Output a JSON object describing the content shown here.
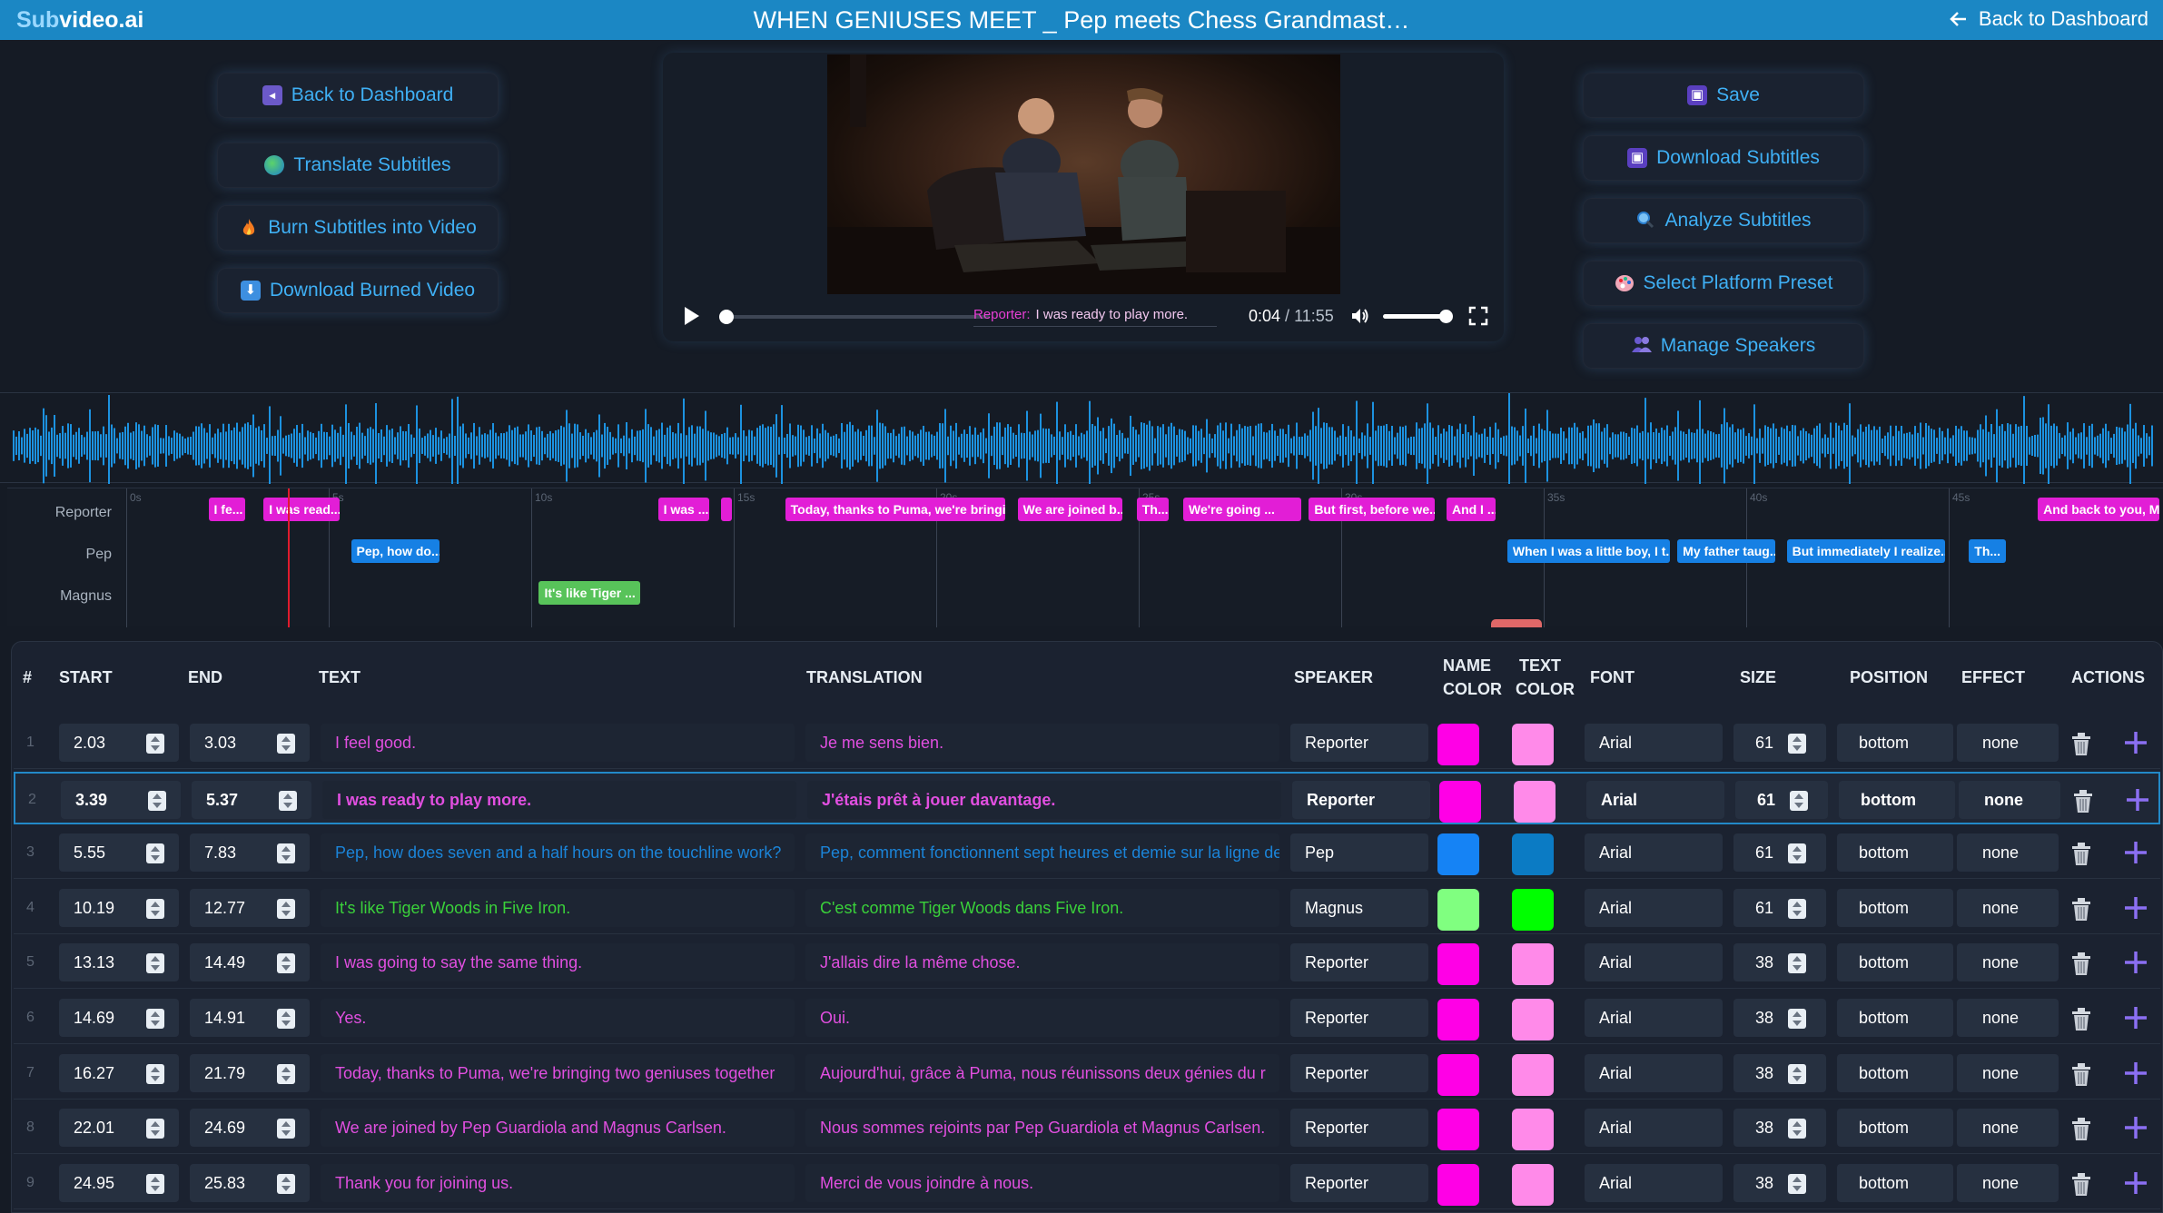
{
  "app": {
    "brand_prefix": "Sub",
    "brand_suffix": "video.ai",
    "video_title": "WHEN GENIUSES MEET _ Pep meets Chess Grandmast…",
    "back_top": "Back to Dashboard"
  },
  "left_buttons": [
    {
      "label": "Back to Dashboard",
      "icon": "back-icon"
    },
    {
      "label": "Translate Subtitles",
      "icon": "globe-icon"
    },
    {
      "label": "Burn Subtitles into Video",
      "icon": "fire-icon"
    },
    {
      "label": "Download Burned Video",
      "icon": "download-arrow-icon"
    }
  ],
  "right_buttons": [
    {
      "label": "Save",
      "icon": "floppy-icon"
    },
    {
      "label": "Download Subtitles",
      "icon": "floppy-icon"
    },
    {
      "label": "Analyze Subtitles",
      "icon": "magnifier-icon"
    },
    {
      "label": "Select Platform Preset",
      "icon": "palette-icon"
    },
    {
      "label": "Manage Speakers",
      "icon": "people-icon"
    }
  ],
  "player": {
    "current_speaker": "Reporter:",
    "current_caption": "I was ready to play more.",
    "current_time": "0:04",
    "separator": " / ",
    "duration": "11:55",
    "progress": 0.006,
    "volume": 1.0
  },
  "timeline": {
    "tracks": [
      "Reporter",
      "Pep",
      "Magnus"
    ],
    "ticks": [
      "0s",
      "5s",
      "10s",
      "15s",
      "20s",
      "25s",
      "30s",
      "35s",
      "40s",
      "45s"
    ],
    "clips": [
      {
        "track": 0,
        "start": 2.03,
        "end": 3.03,
        "label": "I fe..."
      },
      {
        "track": 0,
        "start": 3.39,
        "end": 5.37,
        "label": "I was read..."
      },
      {
        "track": 1,
        "start": 5.55,
        "end": 7.83,
        "label": "Pep, how do..."
      },
      {
        "track": 2,
        "start": 10.19,
        "end": 12.77,
        "label": "It's like Tiger ..."
      },
      {
        "track": 0,
        "start": 13.13,
        "end": 14.49,
        "label": "I was ..."
      },
      {
        "track": 0,
        "start": 14.69,
        "end": 14.91,
        "label": ""
      },
      {
        "track": 0,
        "start": 16.27,
        "end": 21.79,
        "label": "Today, thanks to Puma, we're bringi..."
      },
      {
        "track": 0,
        "start": 22.01,
        "end": 24.69,
        "label": "We are joined b..."
      },
      {
        "track": 0,
        "start": 24.95,
        "end": 25.83,
        "label": "Th..."
      },
      {
        "track": 0,
        "start": 26.1,
        "end": 29.1,
        "label": "We're going ..."
      },
      {
        "track": 0,
        "start": 29.2,
        "end": 32.4,
        "label": "But first, before we..."
      },
      {
        "track": 0,
        "start": 32.6,
        "end": 33.9,
        "label": "And I ..."
      },
      {
        "track": 1,
        "start": 34.1,
        "end": 38.2,
        "label": "When I was a little boy, I t..."
      },
      {
        "track": 1,
        "start": 38.3,
        "end": 40.8,
        "label": "My father taug..."
      },
      {
        "track": 1,
        "start": 41.0,
        "end": 45.0,
        "label": "But immediately I realize..."
      },
      {
        "track": 1,
        "start": 45.5,
        "end": 46.5,
        "label": "Th..."
      },
      {
        "track": 0,
        "start": 47.2,
        "end": 50.5,
        "label": "And back to you, M..."
      }
    ]
  },
  "table": {
    "headers": {
      "num": "#",
      "start": "START",
      "end": "END",
      "text": "TEXT",
      "translation": "TRANSLATION",
      "speaker": "SPEAKER",
      "name_color_1": "NAME",
      "name_color_2": "COLOR",
      "text_color_1": "TEXT",
      "text_color_2": "COLOR",
      "font": "FONT",
      "size": "SIZE",
      "position": "POSITION",
      "effect": "EFFECT",
      "actions": "ACTIONS"
    },
    "rows": [
      {
        "num": "1",
        "start": "2.03",
        "end": "3.03",
        "text": "I feel good.",
        "translation": "Je me sens bien.",
        "speaker": "Reporter",
        "name_color": "#ff00e6",
        "text_color": "#ff8ae9",
        "font": "Arial",
        "size": "61",
        "position": "bottom",
        "effect": "none"
      },
      {
        "num": "2",
        "start": "3.39",
        "end": "5.37",
        "text": "I was ready to play more.",
        "translation": "J'étais prêt à jouer davantage.",
        "speaker": "Reporter",
        "name_color": "#ff00e6",
        "text_color": "#ff8ae9",
        "font": "Arial",
        "size": "61",
        "position": "bottom",
        "effect": "none",
        "selected": true
      },
      {
        "num": "3",
        "start": "5.55",
        "end": "7.83",
        "text": "Pep, how does seven and a half hours on the touchline work?",
        "translation": "Pep, comment fonctionnent sept heures et demie sur la ligne de touche ?",
        "speaker": "Pep",
        "name_color": "#1583f5",
        "text_color": "#0b7bc4",
        "font": "Arial",
        "size": "61",
        "position": "bottom",
        "effect": "none"
      },
      {
        "num": "4",
        "start": "10.19",
        "end": "12.77",
        "text": "It's like Tiger Woods in Five Iron.",
        "translation": "C'est comme Tiger Woods dans Five Iron.",
        "speaker": "Magnus",
        "name_color": "#80ff80",
        "text_color": "#00ff00",
        "font": "Arial",
        "size": "61",
        "position": "bottom",
        "effect": "none"
      },
      {
        "num": "5",
        "start": "13.13",
        "end": "14.49",
        "text": "I was going to say the same thing.",
        "translation": "J'allais dire la même chose.",
        "speaker": "Reporter",
        "name_color": "#ff00e6",
        "text_color": "#ff8ae9",
        "font": "Arial",
        "size": "38",
        "position": "bottom",
        "effect": "none"
      },
      {
        "num": "6",
        "start": "14.69",
        "end": "14.91",
        "text": "Yes.",
        "translation": "Oui.",
        "speaker": "Reporter",
        "name_color": "#ff00e6",
        "text_color": "#ff8ae9",
        "font": "Arial",
        "size": "38",
        "position": "bottom",
        "effect": "none"
      },
      {
        "num": "7",
        "start": "16.27",
        "end": "21.79",
        "text": "Today, thanks to Puma, we're bringing two geniuses together",
        "translation": "Aujourd'hui, grâce à Puma, nous réunissons deux génies du r",
        "speaker": "Reporter",
        "name_color": "#ff00e6",
        "text_color": "#ff8ae9",
        "font": "Arial",
        "size": "38",
        "position": "bottom",
        "effect": "none"
      },
      {
        "num": "8",
        "start": "22.01",
        "end": "24.69",
        "text": "We are joined by Pep Guardiola and Magnus Carlsen.",
        "translation": "Nous sommes rejoints par Pep Guardiola et Magnus Carlsen.",
        "speaker": "Reporter",
        "name_color": "#ff00e6",
        "text_color": "#ff8ae9",
        "font": "Arial",
        "size": "38",
        "position": "bottom",
        "effect": "none"
      },
      {
        "num": "9",
        "start": "24.95",
        "end": "25.83",
        "text": "Thank you for joining us.",
        "translation": "Merci de vous joindre à nous.",
        "speaker": "Reporter",
        "name_color": "#ff00e6",
        "text_color": "#ff8ae9",
        "font": "Arial",
        "size": "38",
        "position": "bottom",
        "effect": "none"
      }
    ]
  },
  "colors": {
    "accent": "#1b87c4",
    "reporter_text": "#e14fe0",
    "pep_text": "#1b84d8",
    "magnus_text": "#3ad13a",
    "translation_text": "#e14fe0"
  }
}
